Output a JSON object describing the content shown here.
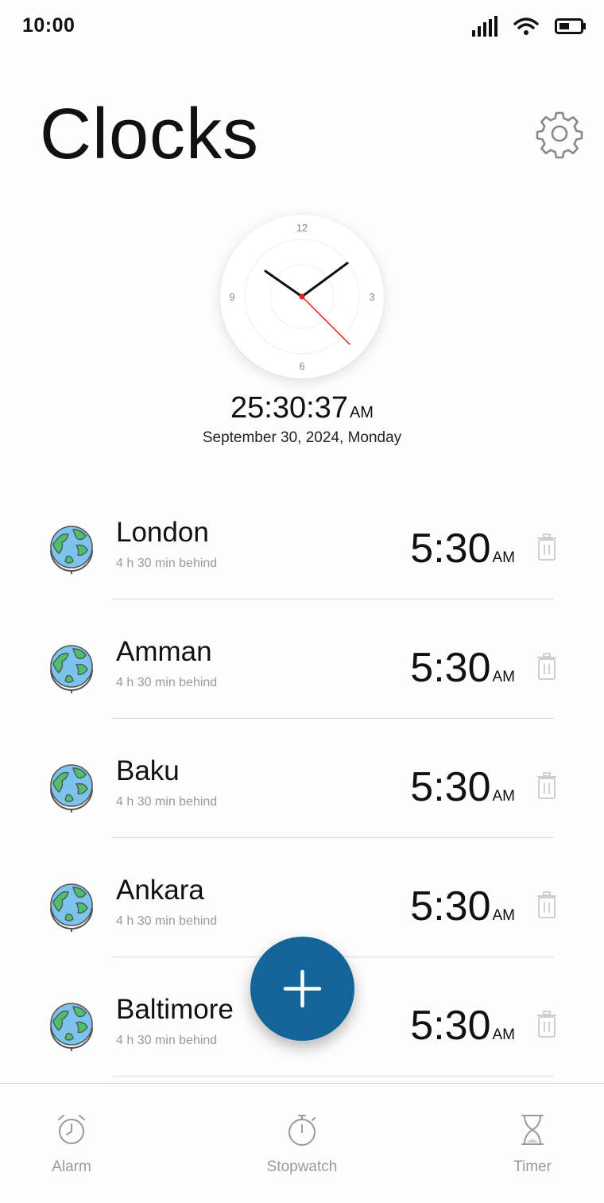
{
  "status_bar": {
    "time": "10:00",
    "icons": [
      "signal-icon",
      "wifi-icon",
      "battery-icon"
    ]
  },
  "header": {
    "title": "Clocks",
    "settings_icon": "gear-icon"
  },
  "main_clock": {
    "dial_numbers": [
      "12",
      "3",
      "6",
      "9"
    ],
    "time": "25:30:37",
    "ampm": "AM",
    "date": "September 30, 2024, Monday",
    "second_hand_color": "#e02020"
  },
  "cities": [
    {
      "name": "London",
      "offset": "4 h 30 min behind",
      "time": "5:30",
      "ampm": "AM"
    },
    {
      "name": "Amman",
      "offset": "4 h 30 min behind",
      "time": "5:30",
      "ampm": "AM"
    },
    {
      "name": "Baku",
      "offset": "4 h 30 min behind",
      "time": "5:30",
      "ampm": "AM"
    },
    {
      "name": "Ankara",
      "offset": "4 h 30 min behind",
      "time": "5:30",
      "ampm": "AM"
    },
    {
      "name": "Baltimore",
      "offset": "4 h 30 min behind",
      "time": "5:30",
      "ampm": "AM"
    }
  ],
  "fab": {
    "icon": "plus-icon",
    "color": "#14649a"
  },
  "bottom_nav": {
    "items": [
      {
        "label": "Alarm",
        "icon": "alarm-clock-icon"
      },
      {
        "label": "Stopwatch",
        "icon": "stopwatch-icon"
      },
      {
        "label": "Timer",
        "icon": "hourglass-icon"
      }
    ]
  }
}
